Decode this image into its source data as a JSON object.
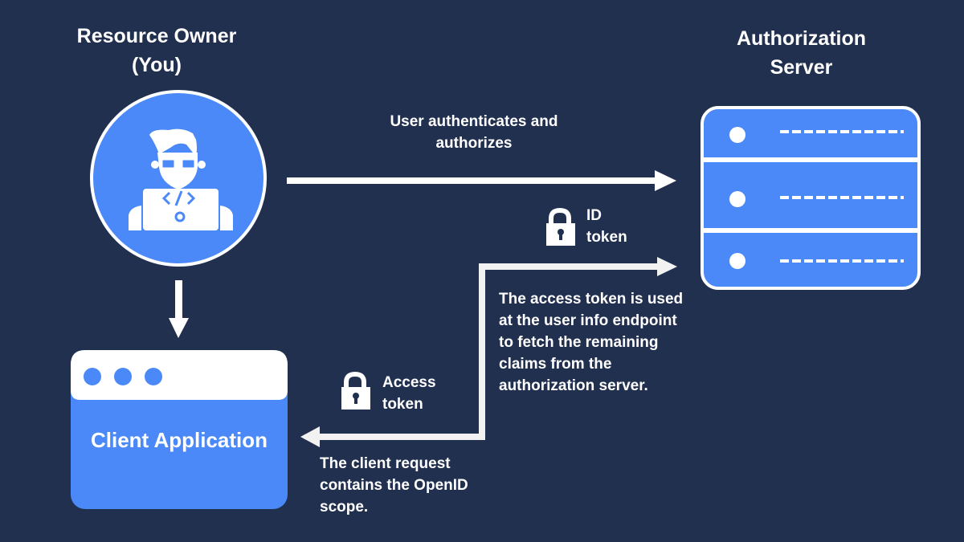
{
  "colors": {
    "background": "#22304f",
    "accent_blue": "#4a89f7",
    "white": "#ffffff",
    "arrow": "#f2f2f2"
  },
  "nodes": {
    "resource_owner": {
      "title": "Resource Owner (You)",
      "icon": "developer-avatar-icon"
    },
    "authorization_server": {
      "title": "Authorization Server",
      "icon": "server-rack-icon",
      "rack_units": 3
    },
    "client_application": {
      "title": "Client Application",
      "icon": "browser-window-icon"
    }
  },
  "edges": [
    {
      "from": "resource_owner",
      "to": "authorization_server",
      "label": "User authenticates and authorizes"
    },
    {
      "from": "resource_owner",
      "to": "client_application",
      "label": ""
    },
    {
      "from": "client_application",
      "to": "authorization_server",
      "label": "The access token is used at the user info endpoint to fetch the remaining claims from the authorization server.",
      "token_label": "ID token",
      "token_icon": "lock-icon"
    },
    {
      "from": "authorization_server",
      "to": "client_application",
      "label": "The client request contains the OpenID scope.",
      "token_label": "Access token",
      "token_icon": "lock-icon"
    }
  ],
  "labels": {
    "owner_title": "Resource Owner (You)",
    "server_title": "Authorization Server",
    "client_app": "Client Application",
    "user_auth": "User authenticates and authorizes",
    "id_token": "ID token",
    "access_token": "Access token",
    "access_desc": "The access token is used at the user info endpoint to fetch the remaining claims from the authorization server.",
    "client_request": "The client request contains the OpenID scope."
  }
}
